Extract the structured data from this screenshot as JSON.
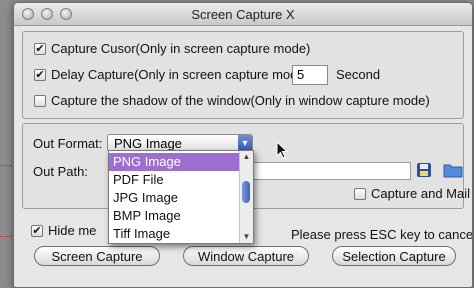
{
  "window": {
    "title": "Screen Capture X"
  },
  "options": {
    "capture_cursor": {
      "label": "Capture Cusor(Only in screen capture mode)",
      "checked": true
    },
    "delay_capture": {
      "label": "Delay Capture(Only in screen capture mode)",
      "checked": true,
      "value": "5",
      "unit": "Second"
    },
    "capture_shadow": {
      "label": "Capture the shadow of the window(Only in window capture mode)",
      "checked": false
    }
  },
  "output": {
    "format_label": "Out Format:",
    "format_value": "PNG Image",
    "path_label": "Out Path:",
    "capture_and_mail": {
      "label": "Capture  and Mail",
      "checked": false
    }
  },
  "dropdown": {
    "options": [
      "PNG Image",
      "PDF File",
      "JPG Image",
      "BMP Image",
      "Tiff Image"
    ],
    "selected_index": 0
  },
  "footer": {
    "hide_me": {
      "label": "Hide me",
      "checked": true
    },
    "hint": "Please press ESC key to cancel",
    "buttons": {
      "screen": "Screen Capture",
      "window": "Window Capture",
      "selection": "Selection  Capture"
    }
  },
  "colors": {
    "menu_highlight": "#9f6fd0",
    "select_arrow": "#3058b8",
    "folder": "#4f8bd8"
  }
}
